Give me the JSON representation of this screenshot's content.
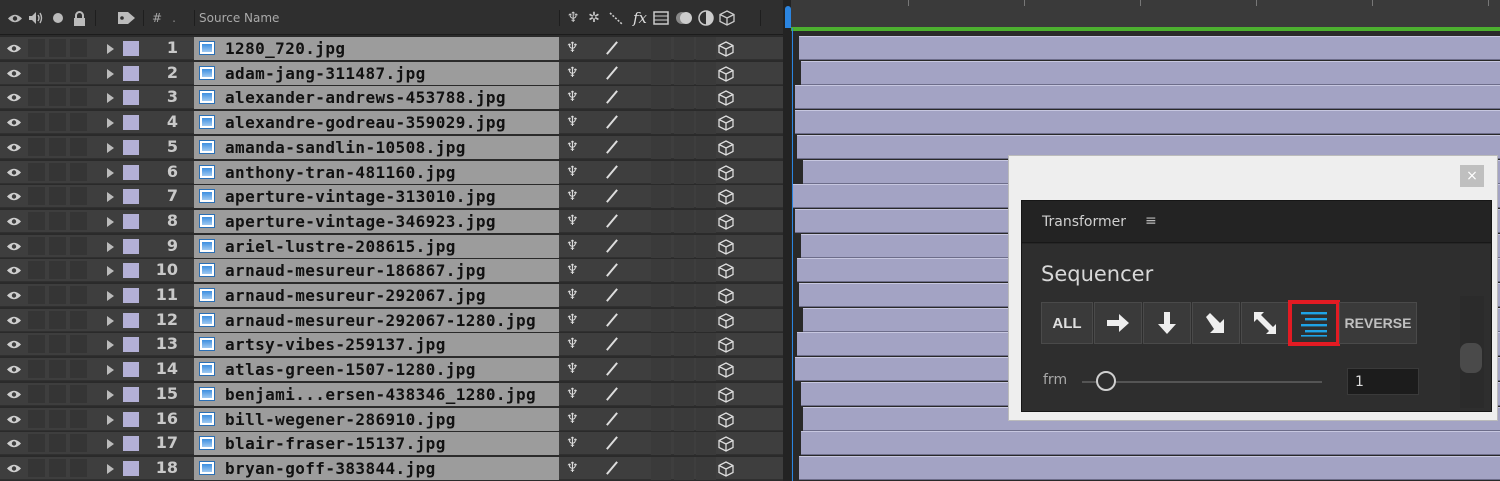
{
  "header": {
    "num_label": "#",
    "source_name_label": "Source Name"
  },
  "layers": [
    {
      "num": "1",
      "name": "1280_720.jpg"
    },
    {
      "num": "2",
      "name": "adam-jang-311487.jpg"
    },
    {
      "num": "3",
      "name": "alexander-andrews-453788.jpg"
    },
    {
      "num": "4",
      "name": "alexandre-godreau-359029.jpg"
    },
    {
      "num": "5",
      "name": "amanda-sandlin-10508.jpg"
    },
    {
      "num": "6",
      "name": "anthony-tran-481160.jpg"
    },
    {
      "num": "7",
      "name": "aperture-vintage-313010.jpg"
    },
    {
      "num": "8",
      "name": "aperture-vintage-346923.jpg"
    },
    {
      "num": "9",
      "name": "ariel-lustre-208615.jpg"
    },
    {
      "num": "10",
      "name": "arnaud-mesureur-186867.jpg"
    },
    {
      "num": "11",
      "name": "arnaud-mesureur-292067.jpg"
    },
    {
      "num": "12",
      "name": "arnaud-mesureur-292067-1280.jpg"
    },
    {
      "num": "13",
      "name": "artsy-vibes-259137.jpg"
    },
    {
      "num": "14",
      "name": "atlas-green-1507-1280.jpg"
    },
    {
      "num": "15",
      "name": "benjami...ersen-438346_1280.jpg"
    },
    {
      "num": "16",
      "name": "bill-wegener-286910.jpg"
    },
    {
      "num": "17",
      "name": "blair-fraser-15137.jpg"
    },
    {
      "num": "18",
      "name": "bryan-goff-383844.jpg"
    }
  ],
  "dialog": {
    "close_label": "×",
    "panel_title": "Transformer",
    "panel_menu": "≡",
    "section_title": "Sequencer",
    "all_label": "ALL",
    "reverse_label": "REVERSE",
    "frm_label": "frm",
    "frm_value": "1",
    "slider_value": 0.1
  },
  "colors": {
    "label": "#b3b0d6",
    "timeline_bar": "#a3a3c4",
    "work_area": "#4caf2f",
    "playhead": "#2b85e0",
    "highlight": "#e31b23"
  }
}
